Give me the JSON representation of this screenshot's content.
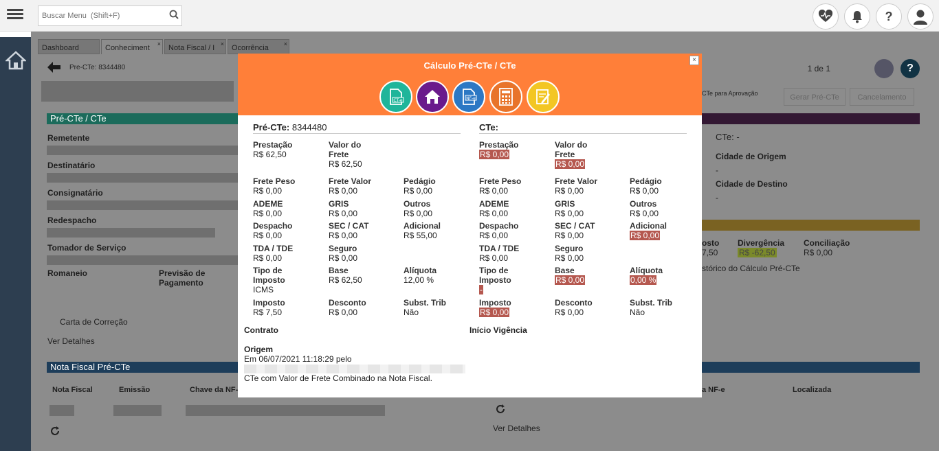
{
  "topbar": {
    "search_placeholder": "Buscar Menu  (Shift+F)"
  },
  "tabs": [
    {
      "label": "Dashboard"
    },
    {
      "label": "Conheciment"
    },
    {
      "label": "Nota Fiscal / I"
    },
    {
      "label": "Ocorrência"
    }
  ],
  "backrow": {
    "title": "Pre-CTe: 8344480",
    "pager": "1 de 1"
  },
  "bg": {
    "section_precte": "Pré-CTe / CTe",
    "remetente": "Remetente",
    "destinatario": "Destinatário",
    "consignatario": "Consignatário",
    "redespacho": "Redespacho",
    "tomador": "Tomador de Serviço",
    "romaneio": "Romaneio",
    "previsao": "Previsão de Pagamento",
    "carta": "Carta de Correção",
    "ver_detalhes": "Ver Detalhes",
    "section_nf": "Nota Fiscal Pré-CTe",
    "nf_col1": "Nota Fiscal",
    "nf_col2": "Emissão",
    "nf_col3": "Chave da NF-",
    "nf_col4": "a NF-e",
    "nf_col5": "Localizada",
    "ver_detalhes2": "Ver Detalhes",
    "aprov": "CTe para Aprovação",
    "gerar": "Gerar Pré-CTe",
    "cancel": "Cancelamento",
    "cte_dash": "CTe: -",
    "cidade_origem": "Cidade de Origem",
    "dash1": "-",
    "cidade_destino": "Cidade de Destino",
    "dash2": "-",
    "custo": "osto",
    "custo_val": "7,50",
    "divergencia": "Divergência",
    "divergencia_val": "R$ -62,50",
    "conciliacao": "Conciliação",
    "conciliacao_val": "R$ 0,00",
    "historico": "stórico do Cálculo Pré-CTe"
  },
  "modal": {
    "title": "Cálculo Pré-CTe / CTe",
    "close": "×",
    "icons": [
      {
        "name": "cte-document-icon",
        "color": "#1fb59a",
        "label": "CT-e"
      },
      {
        "name": "house-icon",
        "color": "#6a1a8c",
        "label": ""
      },
      {
        "name": "nfe-document-icon",
        "color": "#2c78c4",
        "label": "NF-e"
      },
      {
        "name": "calculator-icon",
        "color": "#e8742a",
        "label": ""
      },
      {
        "name": "notepad-edit-icon",
        "color": "#f3c624",
        "label": ""
      }
    ],
    "left_head_label": "Pré-CTe:",
    "left_head_value": "8344480",
    "right_head_label": "CTe:",
    "left": [
      {
        "k": "Prestação",
        "v": "R$ 62,50",
        "col": 0,
        "row": 0
      },
      {
        "k": "Valor do Frete",
        "v": "R$ 62,50",
        "col": 1,
        "row": 0
      },
      {
        "k": "Frete Peso",
        "v": "R$ 0,00",
        "col": 0,
        "row": 1
      },
      {
        "k": "Frete Valor",
        "v": "R$ 0,00",
        "col": 1,
        "row": 1
      },
      {
        "k": "Pedágio",
        "v": "R$ 0,00",
        "col": 2,
        "row": 1
      },
      {
        "k": "ADEME",
        "v": "R$ 0,00",
        "col": 0,
        "row": 2
      },
      {
        "k": "GRIS",
        "v": "R$ 0,00",
        "col": 1,
        "row": 2
      },
      {
        "k": "Outros",
        "v": "R$ 0,00",
        "col": 2,
        "row": 2
      },
      {
        "k": "Despacho",
        "v": "R$ 0,00",
        "col": 0,
        "row": 3
      },
      {
        "k": "SEC / CAT",
        "v": "R$ 0,00",
        "col": 1,
        "row": 3
      },
      {
        "k": "Adicional",
        "v": "R$ 55,00",
        "col": 2,
        "row": 3
      },
      {
        "k": "TDA / TDE",
        "v": "R$ 0,00",
        "col": 0,
        "row": 4
      },
      {
        "k": "Seguro",
        "v": "R$ 0,00",
        "col": 1,
        "row": 4
      },
      {
        "k": "Tipo de Imposto",
        "v": "ICMS",
        "col": 0,
        "row": 5
      },
      {
        "k": "Base",
        "v": "R$ 62,50",
        "col": 1,
        "row": 5
      },
      {
        "k": "Alíquota",
        "v": "12,00 %",
        "col": 2,
        "row": 5
      },
      {
        "k": "Imposto",
        "v": "R$ 7,50",
        "col": 0,
        "row": 6
      },
      {
        "k": "Desconto",
        "v": "R$ 0,00",
        "col": 1,
        "row": 6
      },
      {
        "k": "Subst. Trib",
        "v": "Não",
        "col": 2,
        "row": 6
      }
    ],
    "right": [
      {
        "k": "Prestação",
        "v": "R$ 0,00",
        "col": 0,
        "row": 0,
        "red": true
      },
      {
        "k": "Valor do Frete",
        "v": "R$ 0,00",
        "col": 1,
        "row": 0,
        "red": true
      },
      {
        "k": "Frete Peso",
        "v": "R$ 0,00",
        "col": 0,
        "row": 1
      },
      {
        "k": "Frete Valor",
        "v": "R$ 0,00",
        "col": 1,
        "row": 1
      },
      {
        "k": "Pedágio",
        "v": "R$ 0,00",
        "col": 2,
        "row": 1
      },
      {
        "k": "ADEME",
        "v": "R$ 0,00",
        "col": 0,
        "row": 2
      },
      {
        "k": "GRIS",
        "v": "R$ 0,00",
        "col": 1,
        "row": 2
      },
      {
        "k": "Outros",
        "v": "R$ 0,00",
        "col": 2,
        "row": 2
      },
      {
        "k": "Despacho",
        "v": "R$ 0,00",
        "col": 0,
        "row": 3
      },
      {
        "k": "SEC / CAT",
        "v": "R$ 0,00",
        "col": 1,
        "row": 3
      },
      {
        "k": "Adicional",
        "v": "R$ 0,00",
        "col": 2,
        "row": 3,
        "red": true
      },
      {
        "k": "TDA / TDE",
        "v": "R$ 0,00",
        "col": 0,
        "row": 4
      },
      {
        "k": "Seguro",
        "v": "R$ 0,00",
        "col": 1,
        "row": 4
      },
      {
        "k": "Tipo de Imposto",
        "v": "-",
        "col": 0,
        "row": 5,
        "red": true
      },
      {
        "k": "Base",
        "v": "R$ 0,00",
        "col": 1,
        "row": 5,
        "red": true
      },
      {
        "k": "Alíquota",
        "v": "0,00 %",
        "col": 2,
        "row": 5,
        "red": true
      },
      {
        "k": "Imposto",
        "v": "R$ 0,00",
        "col": 0,
        "row": 6,
        "red": true
      },
      {
        "k": "Desconto",
        "v": "R$ 0,00",
        "col": 1,
        "row": 6
      },
      {
        "k": "Subst. Trib",
        "v": "Não",
        "col": 2,
        "row": 6
      }
    ],
    "contrato": "Contrato",
    "inicio_vigencia": "Início Vigência",
    "origem": "Origem",
    "origem_text": "Em 06/07/2021 11:18:29 pelo",
    "obs": "CTe com Valor de Frete Combinado na Nota Fiscal."
  },
  "colors": {
    "orange": "#ff7f39",
    "red_value": "#b5584f"
  }
}
